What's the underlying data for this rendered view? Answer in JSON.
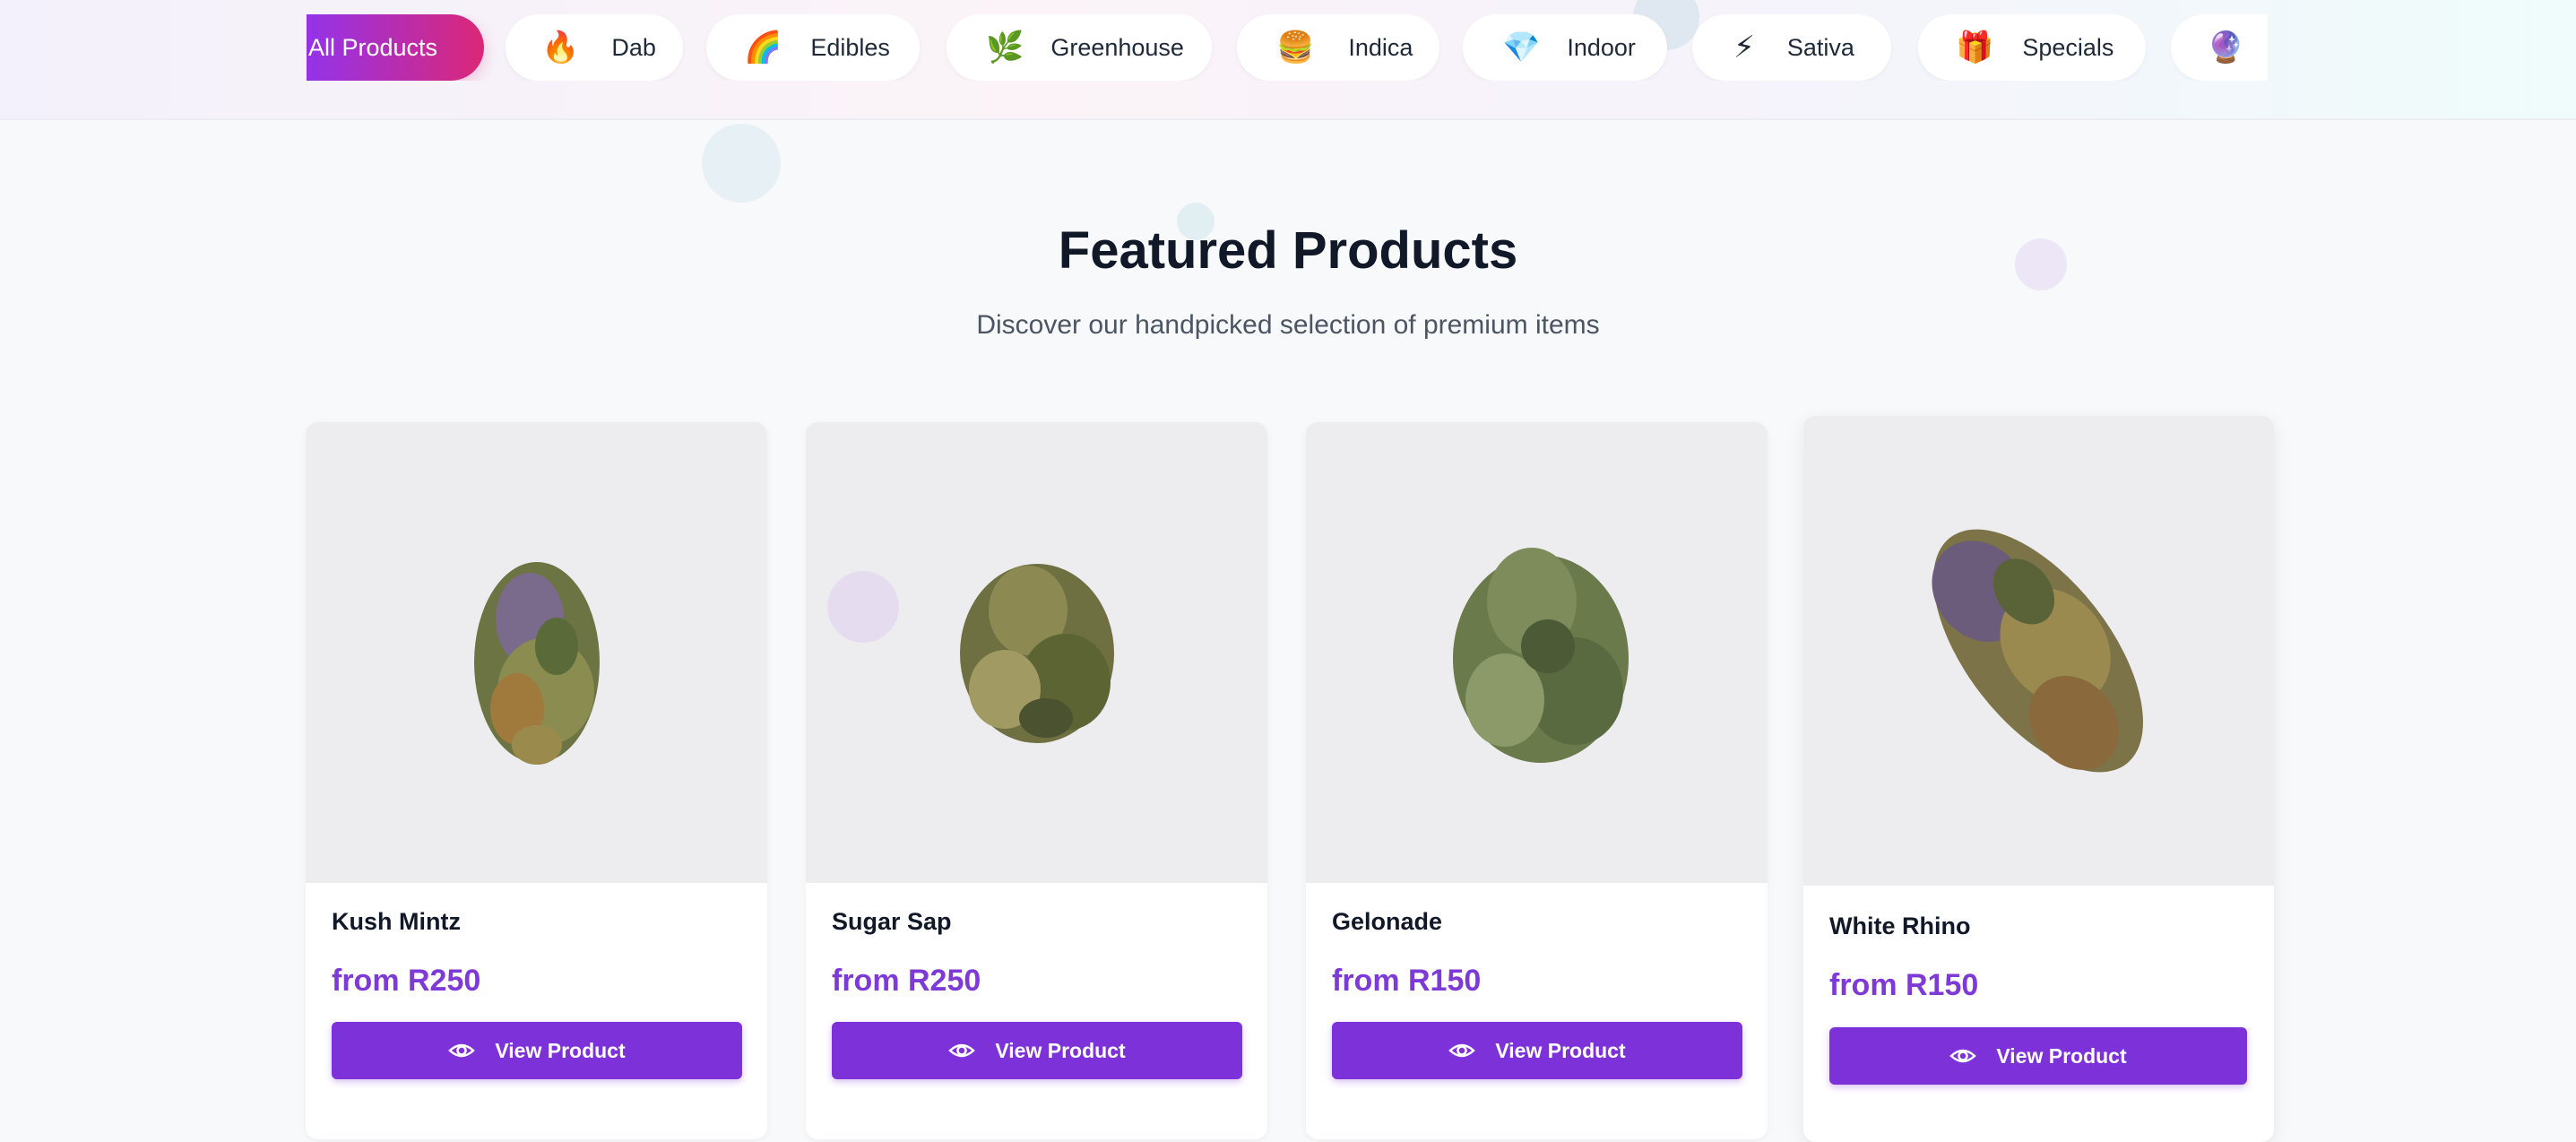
{
  "categories": [
    {
      "label": "All Products",
      "emoji": "",
      "active": true
    },
    {
      "label": "Dab",
      "emoji": "🔥",
      "active": false
    },
    {
      "label": "Edibles",
      "emoji": "🌈",
      "active": false
    },
    {
      "label": "Greenhouse",
      "emoji": "🌿",
      "active": false
    },
    {
      "label": "Indica",
      "emoji": "🍔",
      "active": false
    },
    {
      "label": "Indoor",
      "emoji": "💎",
      "active": false
    },
    {
      "label": "Sativa",
      "emoji": "⚡",
      "active": false
    },
    {
      "label": "Specials",
      "emoji": "🎁",
      "active": false
    },
    {
      "label": "",
      "emoji": "🔮",
      "active": false
    }
  ],
  "featured": {
    "title": "Featured Products",
    "subtitle": "Discover our handpicked selection of premium items"
  },
  "products": [
    {
      "name": "Kush Mintz",
      "price": "from R250",
      "button": "View Product"
    },
    {
      "name": "Sugar Sap",
      "price": "from R250",
      "button": "View Product"
    },
    {
      "name": "Gelonade",
      "price": "from R150",
      "button": "View Product"
    },
    {
      "name": "White Rhino",
      "price": "from R150",
      "button": "View Product"
    }
  ],
  "colors": {
    "accent": "#7d32d9",
    "price": "#7e3ad6",
    "gradient_start": "#9333ea",
    "gradient_end": "#db2777",
    "image_bg": "#edecef"
  },
  "icons": {
    "view_button": "eye-icon"
  }
}
